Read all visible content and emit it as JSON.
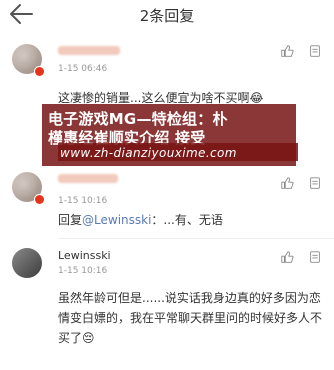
{
  "header": {
    "title": "2条回复"
  },
  "comments": [
    {
      "time": "1-15 06:46",
      "text": "这凄惨的销量...这么便宜为啥不买啊",
      "emoji": "😂"
    },
    {
      "time": "1-15 10:16",
      "time2": "1-15 10:16",
      "reply_prefix": "回复",
      "mention": "@Lewinsski",
      "reply_text": "：...有、无语"
    },
    {
      "name": "Lewinsski",
      "time": "1-15 10:16",
      "text": "虽然年龄可但是......说实话我身边真的好多因为恋情变白嫖的，我在平常聊天群里问的时候好多人不买了",
      "emoji": "😔"
    }
  ],
  "watermark": {
    "line1": "电子游戏MG—特检组：朴",
    "line2": "槿惠经崔顺实介绍 接受",
    "url": "www.zh-dianziyouxime.com"
  },
  "colors": {
    "badge": "#e8321b",
    "mention": "#5b7ab8",
    "banner": "#781414"
  }
}
